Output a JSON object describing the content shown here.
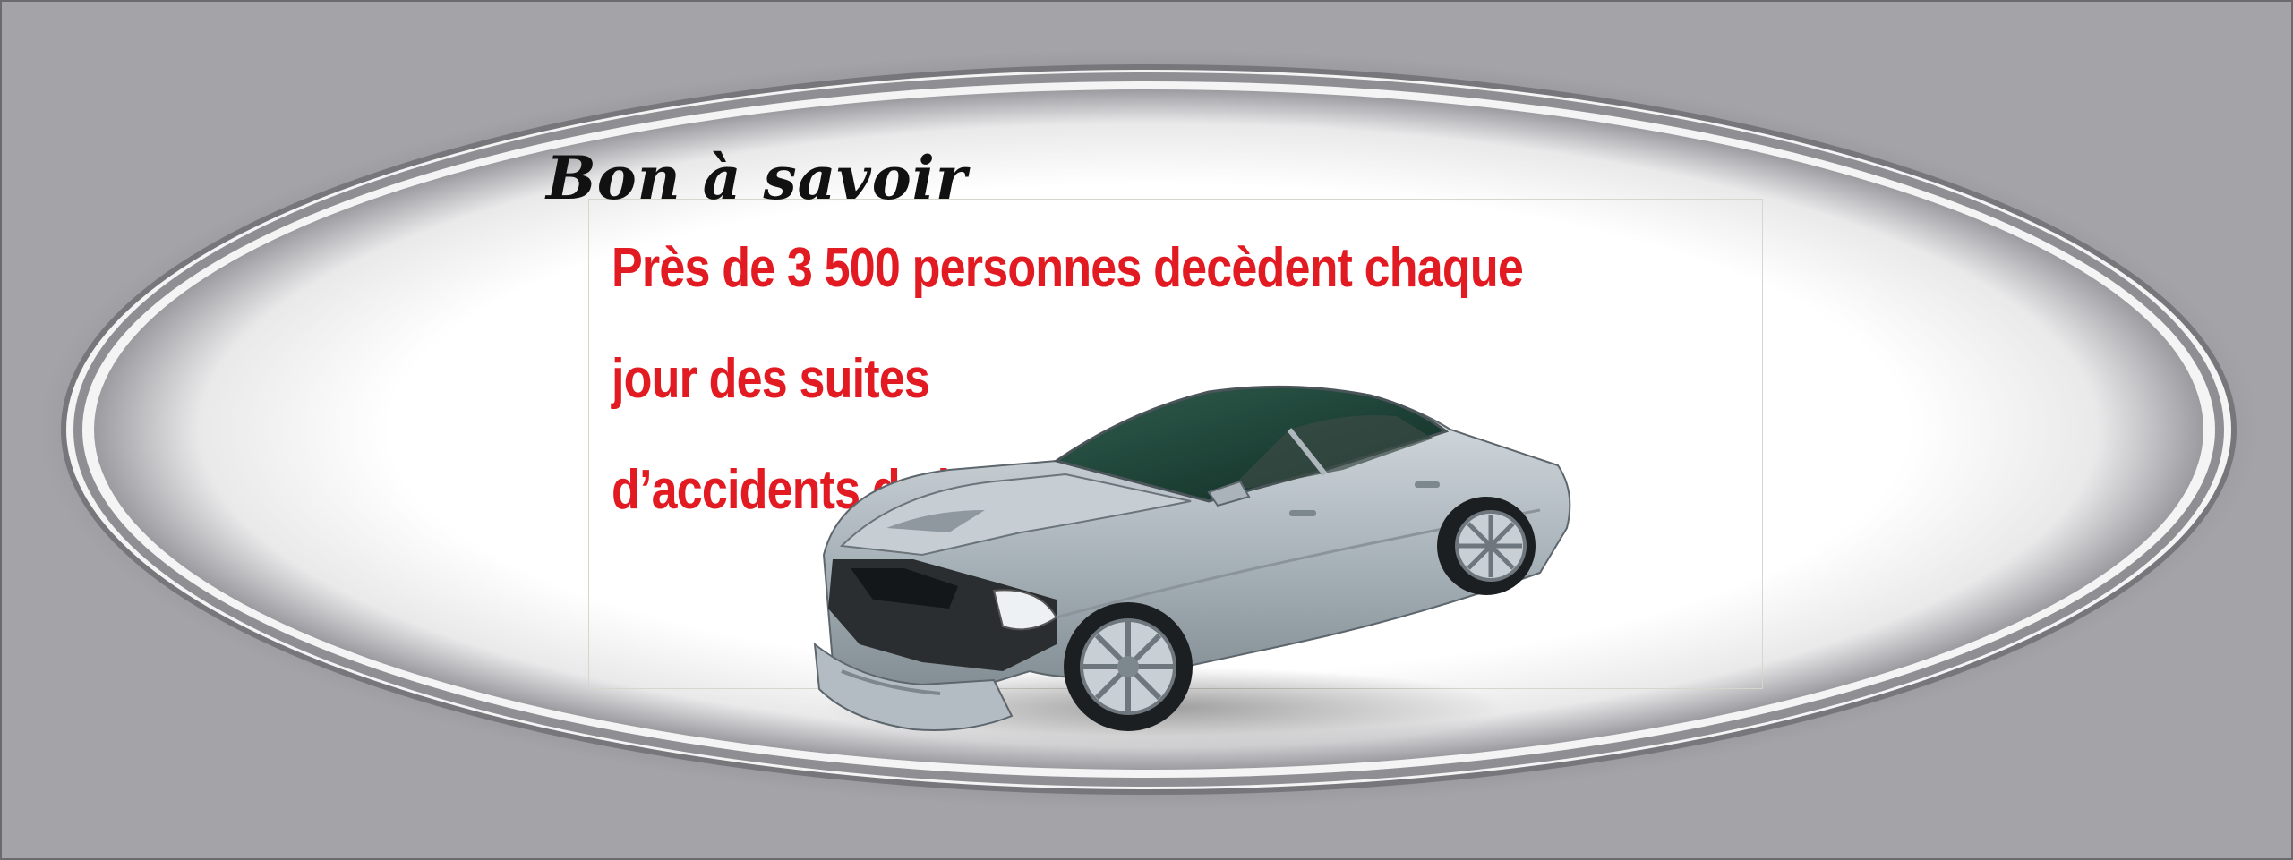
{
  "banner": {
    "heading": "Bon à savoir",
    "message_line1": "Près de 3 500 personnes decèdent chaque jour des suites",
    "message_line2": "d’accidents de la route."
  },
  "colors": {
    "background": "#a4a3a8",
    "oval_fill": "#ffffff",
    "message_text": "#e21b23",
    "heading_text": "#111111",
    "car_body": "#b8c1c8"
  },
  "image": {
    "subject": "damaged-silver-car"
  }
}
